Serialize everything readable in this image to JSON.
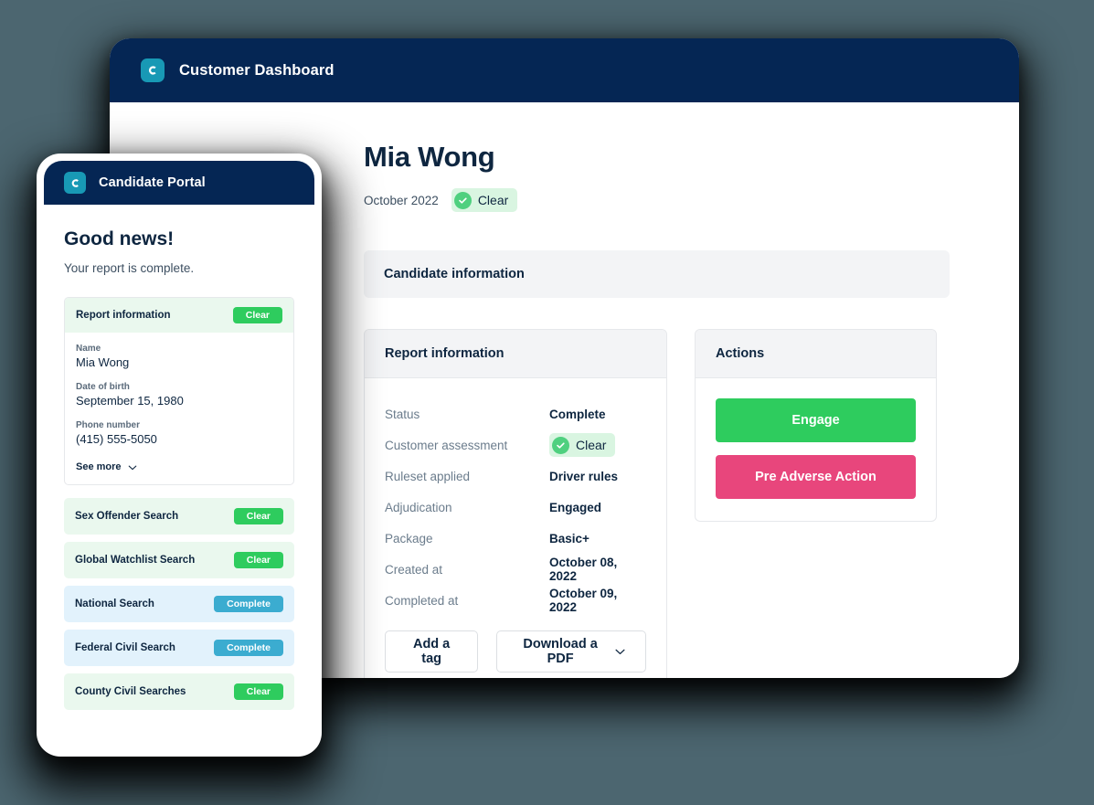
{
  "dashboard": {
    "titlebar": {
      "logo_icon": "c-logo-icon",
      "title": "Customer Dashboard"
    },
    "candidate_name": "Mia Wong",
    "report_month": "October 2022",
    "status_badge": {
      "label": "Clear",
      "icon": "check-circle-icon"
    },
    "section_title": "Candidate information",
    "report_panel": {
      "header": "Report information",
      "rows": [
        {
          "key": "Status",
          "value": "Complete",
          "type": "text"
        },
        {
          "key": "Customer assessment",
          "value": "Clear",
          "type": "badge"
        },
        {
          "key": "Ruleset applied",
          "value": "Driver rules",
          "type": "text"
        },
        {
          "key": "Adjudication",
          "value": "Engaged",
          "type": "text"
        },
        {
          "key": "Package",
          "value": "Basic+",
          "type": "text"
        },
        {
          "key": "Created at",
          "value": "October 08, 2022",
          "type": "text"
        },
        {
          "key": "Completed at",
          "value": "October 09, 2022",
          "type": "text"
        }
      ],
      "add_tag_label": "Add a tag",
      "download_pdf_label": "Download a PDF",
      "download_pdf_icon": "chevron-down-icon"
    },
    "actions_panel": {
      "header": "Actions",
      "engage_label": "Engage",
      "pre_adverse_label": "Pre Adverse Action"
    }
  },
  "portal": {
    "titlebar": {
      "logo_icon": "c-logo-icon",
      "title": "Candidate Portal"
    },
    "heading": "Good news!",
    "subheading": "Your report is complete.",
    "report_card": {
      "title": "Report information",
      "status": "Clear",
      "fields": [
        {
          "label": "Name",
          "value": "Mia Wong"
        },
        {
          "label": "Date of birth",
          "value": "September 15, 1980"
        },
        {
          "label": "Phone number",
          "value": "(415) 555-5050"
        }
      ],
      "see_more_label": "See more",
      "see_more_icon": "chevron-down-icon"
    },
    "searches": [
      {
        "label": "Sex Offender Search",
        "status": "Clear",
        "tone": "green"
      },
      {
        "label": "Global Watchlist Search",
        "status": "Clear",
        "tone": "green"
      },
      {
        "label": "National Search",
        "status": "Complete",
        "tone": "blue"
      },
      {
        "label": "Federal Civil Search",
        "status": "Complete",
        "tone": "blue"
      },
      {
        "label": "County Civil Searches",
        "status": "Clear",
        "tone": "green"
      }
    ]
  },
  "colors": {
    "page_background": "#4c6670",
    "navy": "#052654",
    "logo_teal": "#1899b5",
    "green": "#2ecc5e",
    "green_soft": "#eaf8ee",
    "blue_chip": "#3bacd0",
    "blue_soft": "#e2f2fc",
    "pink": "#e8467c"
  }
}
